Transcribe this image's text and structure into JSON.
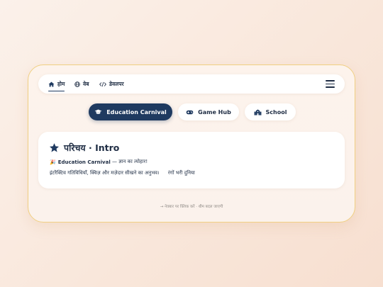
{
  "nav": {
    "items": [
      {
        "label": "होम",
        "icon": "home-icon",
        "active": true
      },
      {
        "label": "वेब",
        "icon": "globe-icon"
      },
      {
        "label": "डेवलपर",
        "icon": "code-icon"
      }
    ],
    "menu_icon": "hamburger-icon"
  },
  "pills": [
    {
      "label": "Education Carnival",
      "icon": "graduation-cap-icon",
      "active": true
    },
    {
      "label": "Game Hub",
      "icon": "gamepad-icon"
    },
    {
      "label": "School",
      "icon": "school-icon"
    }
  ],
  "content": {
    "title": "परिचय · Intro",
    "title_icon": "star-icon",
    "line1_emoji": "🎉",
    "line1_strong": "Education Carnival",
    "line1_rest": "— ज्ञान का त्योहार!",
    "line2_main": "इंटरैक्टिव गतिविधियाँ, क्विज़ और मज़ेदार सीखने का अनुभव।",
    "line2_tag": "रंगों भरी दुनिया"
  },
  "hint": "→ नेवबार पर क्लिक करें · थीम बदल जाएगी",
  "colors": {
    "accent": "#1f3a60",
    "border": "#f0cf82",
    "text": "#1f2d44"
  }
}
